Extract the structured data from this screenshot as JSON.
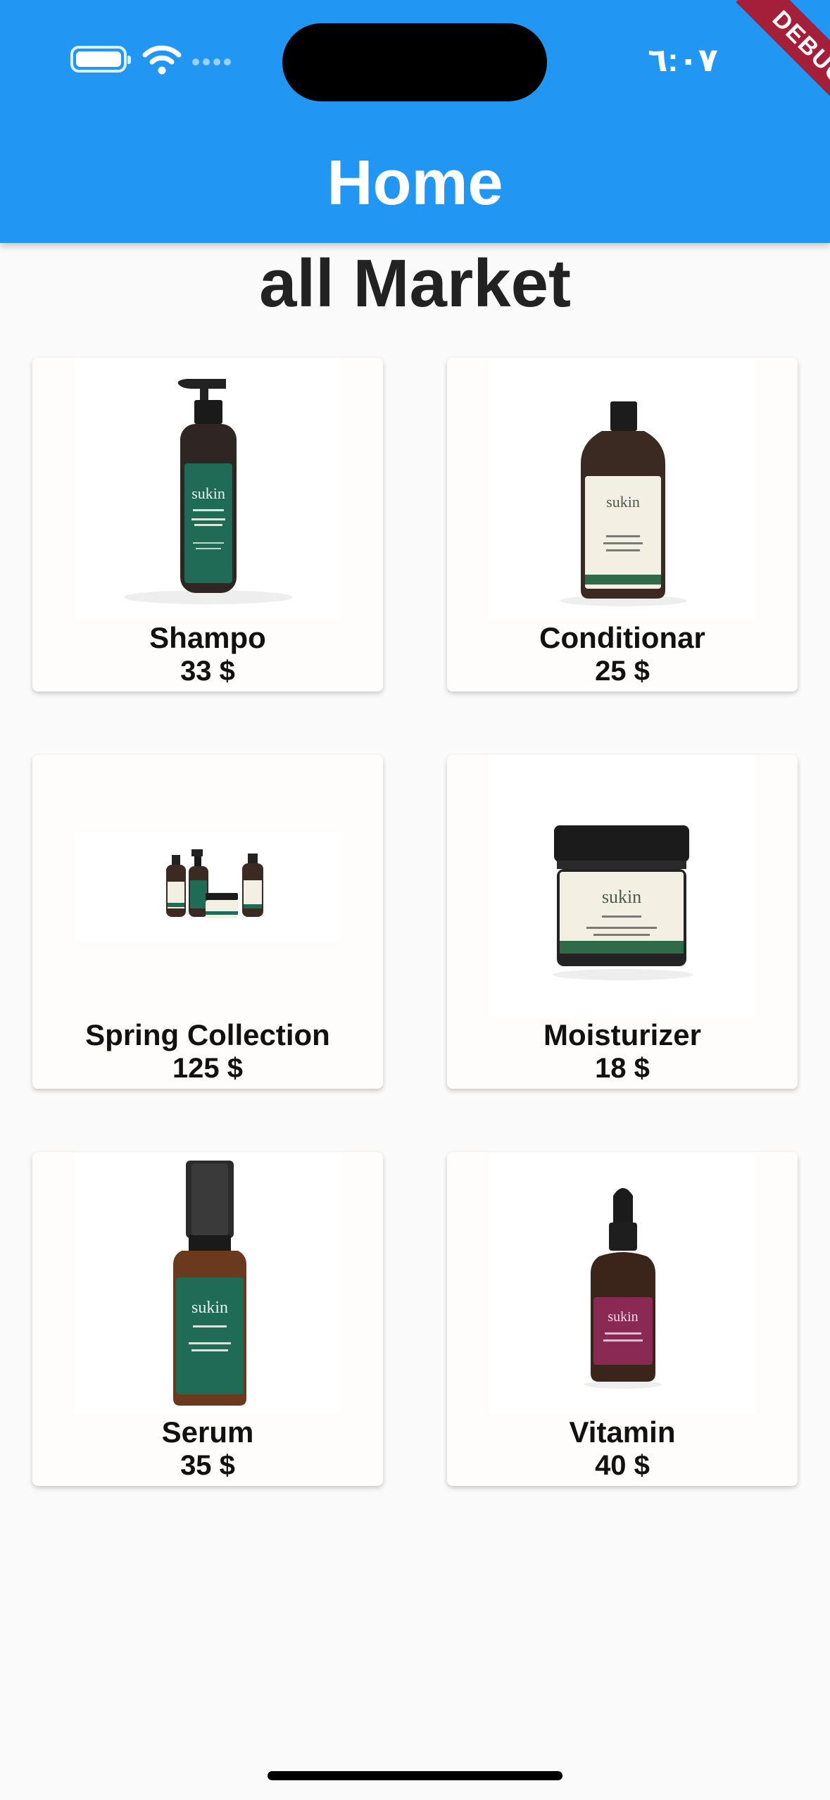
{
  "status_bar": {
    "time": "٦:٠٧"
  },
  "app_bar": {
    "title": "Home",
    "debug_banner": "DEBUG"
  },
  "main": {
    "heading": "all Market",
    "products": [
      {
        "name": "Shampo",
        "price": "33 $"
      },
      {
        "name": "Conditionar",
        "price": "25 $"
      },
      {
        "name": "Spring Collection",
        "price": "125 $"
      },
      {
        "name": "Moisturizer",
        "price": "18 $"
      },
      {
        "name": "Serum",
        "price": "35 $"
      },
      {
        "name": "Vitamin",
        "price": "40 $"
      }
    ]
  },
  "colors": {
    "app_bar": "#2196f3",
    "debug_banner": "#a31f3a",
    "background": "#fafafa",
    "brand_green": "#1f6b55",
    "cream_label": "#f3efe2",
    "berry_label": "#8a2a52"
  }
}
